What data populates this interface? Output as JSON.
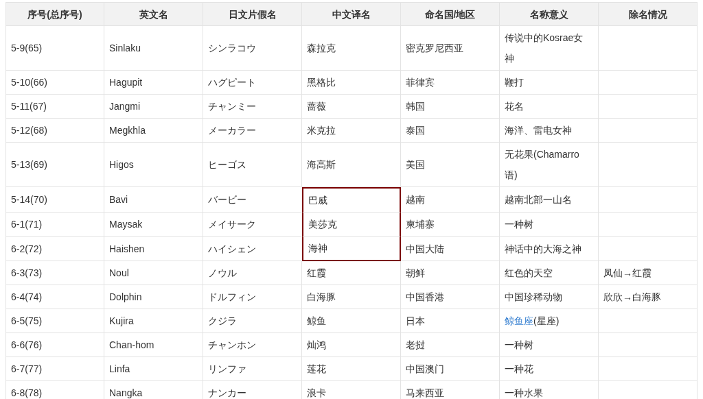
{
  "table": {
    "columns": [
      "序号(总序号)",
      "英文名",
      "日文片假名",
      "中文译名",
      "命名国/地区",
      "名称意义",
      "除名情况"
    ],
    "rows": [
      {
        "number": "5-9(65)",
        "english": "Sinlaku",
        "katakana": "シンラコウ",
        "chinese": "森拉克",
        "country": "密克罗尼西亚",
        "meaning": "传说中的Kosrae女神",
        "highlighted": false
      },
      {
        "number": "5-10(66)",
        "english": "Hagupit",
        "katakana": "ハグピート",
        "chinese": "黑格比",
        "country": "菲律宾",
        "meaning": "鞭打",
        "highlighted": false
      },
      {
        "number": "5-11(67)",
        "english": "Jangmi",
        "katakana": "チャンミー",
        "chinese": "蔷薇",
        "country": "韩国",
        "meaning": "花名",
        "highlighted": false
      },
      {
        "number": "5-12(68)",
        "english": "Megkhla",
        "katakana": "メーカラー",
        "chinese": "米克拉",
        "country": "泰国",
        "meaning": "海洋、雷电女神",
        "highlighted": false
      },
      {
        "number": "5-13(69)",
        "english": "Higos",
        "katakana": "ヒーゴス",
        "chinese": "海高斯",
        "country": "美国",
        "meaning": "无花果(Chamarro语)",
        "highlighted": false
      },
      {
        "number": "5-14(70)",
        "english": "Bavi",
        "katakana": "バービー",
        "chinese": "巴威",
        "country": "越南",
        "meaning": "越南北部一山名",
        "highlighted": true
      },
      {
        "number": "6-1(71)",
        "english": "Maysak",
        "katakana": "メイサーク",
        "chinese": "美莎克",
        "country": "柬埔寨",
        "meaning": "一种树",
        "highlighted": true
      },
      {
        "number": "6-2(72)",
        "english": "Haishen",
        "katakana": "ハイシェン",
        "chinese": "海神",
        "country": "中国大陆",
        "meaning": "神话中的大海之神",
        "highlighted": true
      },
      {
        "number": "6-3(73)",
        "english": "Noul",
        "katakana": "ノウル",
        "chinese": "红霞",
        "country": "朝鲜",
        "meaning": "红色的天空",
        "removal": "凤仙→红霞",
        "highlighted": false
      },
      {
        "number": "6-4(74)",
        "english": "Dolphin",
        "katakana": "ドルフィン",
        "chinese": "白海豚",
        "country": "中国香港",
        "meaning": "中国珍稀动物",
        "removal": "欣欣→白海豚",
        "highlighted": false
      },
      {
        "number": "6-5(75)",
        "english": "Kujira",
        "katakana": "クジラ",
        "chinese": "鲸鱼",
        "country": "日本",
        "meaning_link": "鲸鱼座",
        "meaning": "(星座)",
        "highlighted": false
      },
      {
        "number": "6-6(76)",
        "english": "Chan-hom",
        "katakana": "チャンホン",
        "chinese": "灿鸿",
        "country": "老挝",
        "meaning": "一种树",
        "highlighted": false
      },
      {
        "number": "6-7(77)",
        "english": "Linfa",
        "katakana": "リンファ",
        "chinese": "莲花",
        "country": "中国澳门",
        "meaning": "一种花",
        "highlighted": false
      },
      {
        "number": "6-8(78)",
        "english": "Nangka",
        "katakana": "ナンカー",
        "chinese": "浪卡",
        "country": "马来西亚",
        "meaning": "一种水果",
        "highlighted": false
      }
    ]
  }
}
